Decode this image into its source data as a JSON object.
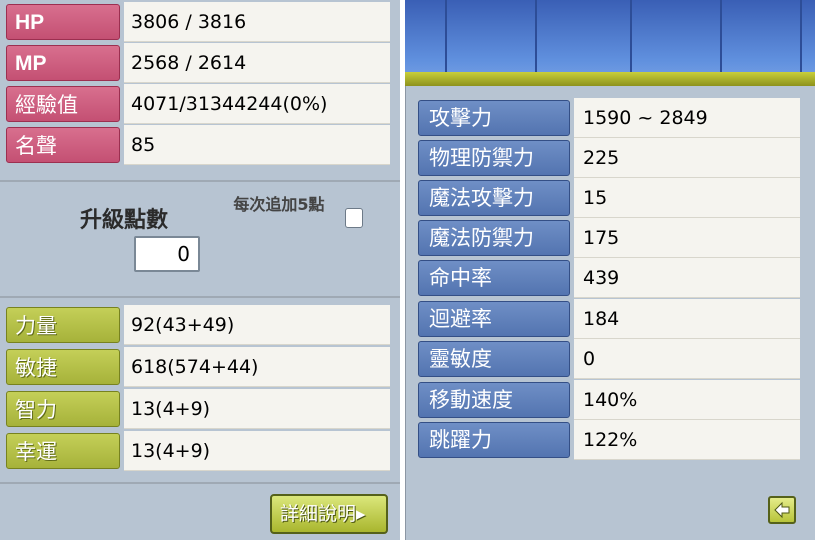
{
  "base_stats": [
    {
      "label": "HP",
      "value": "3806 / 3816"
    },
    {
      "label": "MP",
      "value": "2568 / 2614"
    },
    {
      "label": "經驗值",
      "value": "4071/31344244(0%)"
    },
    {
      "label": "名聲",
      "value": "85"
    }
  ],
  "ability_points": {
    "label": "升級點數",
    "value": "0",
    "auto_label": "每次追加5點",
    "auto_checked": false
  },
  "main_stats": [
    {
      "label": "力量",
      "value": "92(43+49)"
    },
    {
      "label": "敏捷",
      "value": "618(574+44)"
    },
    {
      "label": "智力",
      "value": "13(4+9)"
    },
    {
      "label": "幸運",
      "value": "13(4+9)"
    }
  ],
  "detail_button": {
    "label": "詳細說明",
    "arrow": "▸"
  },
  "detail_stats": [
    {
      "label": "攻擊力",
      "value": "1590 ~ 2849"
    },
    {
      "label": "物理防禦力",
      "value": "225"
    },
    {
      "label": "魔法攻擊力",
      "value": "15"
    },
    {
      "label": "魔法防禦力",
      "value": "175"
    },
    {
      "label": "命中率",
      "value": "439"
    },
    {
      "label": "迴避率",
      "value": "184"
    },
    {
      "label": "靈敏度",
      "value": "0"
    },
    {
      "label": "移動速度",
      "value": "140%"
    },
    {
      "label": "跳躍力",
      "value": "122%"
    }
  ],
  "back_button": {
    "icon": "back-arrow-icon"
  },
  "colors": {
    "base_label": "#c45073",
    "main_label": "#a6b23a",
    "detail_label": "#5374b0",
    "panel_bg": "#b7c4d2",
    "value_bg": "#f5f4ef"
  }
}
